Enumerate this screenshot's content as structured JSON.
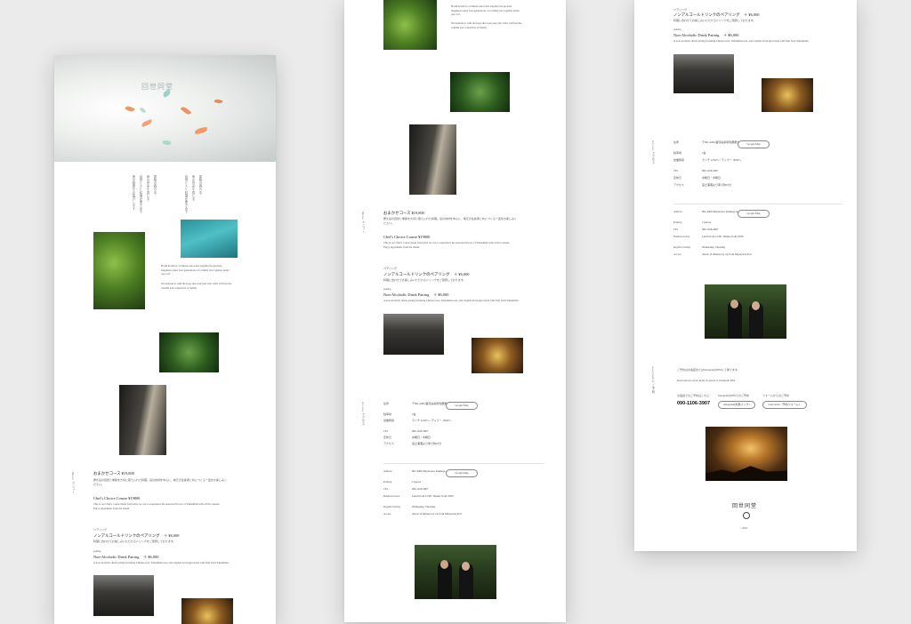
{
  "common": {
    "logo": "回世同堂",
    "section_menu": "Menu メニュー",
    "section_access": "Access アクセス",
    "section_reservation": "reservation ご予約"
  },
  "intro": {
    "lines_jp": [
      "原始の森の中、",
      "命の営みを感じる",
      "自然と人と料理が響き合う",
      "食の時間をお届けします"
    ],
    "en_1": "Hoshi Kosha is a Chinese place that supplies the greatest happiness when four generations of a family live together under one roof.",
    "en_2": "We dedicate it with the hope that everyone who visits will feel the warmth and connection of family."
  },
  "menu": {
    "course_jp": "おまかせコース ¥19,800",
    "course_desc_jp": "屋久島の自然と季節を大切に取り入れた料理。島の食材を中心に、地元の生産者と共につくる一皿をお楽しみください。",
    "course_en": "Chef's Choice Course ¥19800",
    "course_en_desc": "This is our Chef's course made from what we can to experience the seasonal flavors of Yakushima with all five senses. Enjoy ingredients from the island.",
    "pairing_small": "ペアリング",
    "pairing_jp": "ノンアルコールドリンクのペアリング　＋ ¥6,000",
    "pairing_desc_jp": "料理に合わせてお楽しみいただけるドリンクをご用意しております。",
    "pairing_en_small": "pairing",
    "pairing_en": "Non-Alcoholic Drink Pairing　＋ ¥6,000",
    "pairing_en_desc": "A non-alcoholic drink pairing featuring Chinese teas, Yakushima teas, and original beverages made with fruit from Yakushima."
  },
  "access": {
    "rows": [
      {
        "label": "住所",
        "value": "〒891-4406 鹿児島県熊毛郡屋久島町宮之浦"
      },
      {
        "label": "駐車場",
        "value": "2台"
      },
      {
        "label": "営業時間",
        "value": "ランチ 12:00〜 / ディナー 18:00〜"
      },
      {
        "label": "TEL",
        "value": "090-1106-3907"
      },
      {
        "label": "定休日",
        "value": "水曜日・木曜日"
      },
      {
        "label": "アクセス",
        "value": "宮之浦港より車で約10分"
      }
    ],
    "rows_en": [
      {
        "label": "Address",
        "value": "891-4406 Miyanoura, Kumage-gun"
      },
      {
        "label": "Parking",
        "value": "2 spaces"
      },
      {
        "label": "TEL",
        "value": "090-1106-3907"
      },
      {
        "label": "Business hours",
        "value": "Lunch from 12:00 / Dinner from 18:00"
      },
      {
        "label": "Regular holiday",
        "value": "Wednesday, Thursday"
      },
      {
        "label": "Access",
        "value": "About 10 minutes by car from Miyanoura Port"
      }
    ],
    "map_button": "Google Map"
  },
  "reservation": {
    "intro_jp": "ご予約はお電話またはInstagramのDMにて承ります。",
    "intro_en": "Reservations can be made by phone or Instagram DM.",
    "phone_label": "お電話でのご予約はこちら",
    "instagram_label": "InstagramのDMでのご予約",
    "form_label": "フォームからのご予約",
    "phone": "090-1106-3907",
    "instagram_button": "Instagram(外部リンク)",
    "form_button": "reservation（予約フォーム）",
    "copyright": "©2024"
  }
}
